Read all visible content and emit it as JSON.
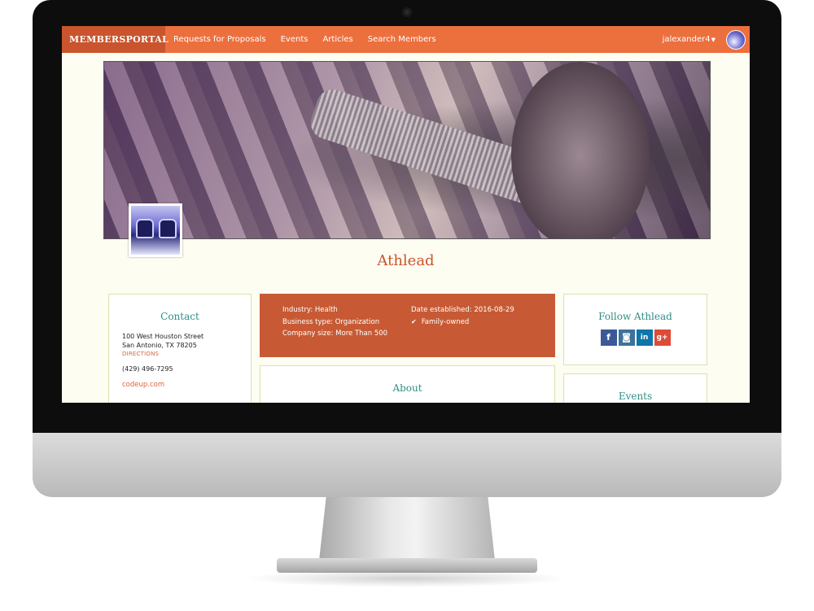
{
  "navbar": {
    "brand": "MEMBERSPORTAL",
    "links": [
      "Requests for Proposals",
      "Events",
      "Articles",
      "Search Members"
    ],
    "user": "jalexander4",
    "color": "#ec6f3e",
    "brand_color": "#c9542d"
  },
  "company": {
    "name": "Athlead"
  },
  "contact": {
    "title": "Contact",
    "address_line1": "100 West Houston Street",
    "address_line2": "San Antonio, TX 78205",
    "directions": "DIRECTIONS",
    "phone": "(429) 496-7295",
    "website": "codeup.com"
  },
  "info": {
    "industry": "Industry: Health",
    "business_type": "Business type: Organization",
    "company_size": "Company size: More Than 500",
    "date_established": "Date established: 2016-08-29",
    "family_owned": "Family-owned",
    "color": "#c75a34"
  },
  "about": {
    "title": "About"
  },
  "follow": {
    "title": "Follow Athlead",
    "icons": [
      "facebook-icon",
      "instagram-icon",
      "linkedin-icon",
      "google-plus-icon"
    ]
  },
  "events": {
    "title": "Events"
  }
}
